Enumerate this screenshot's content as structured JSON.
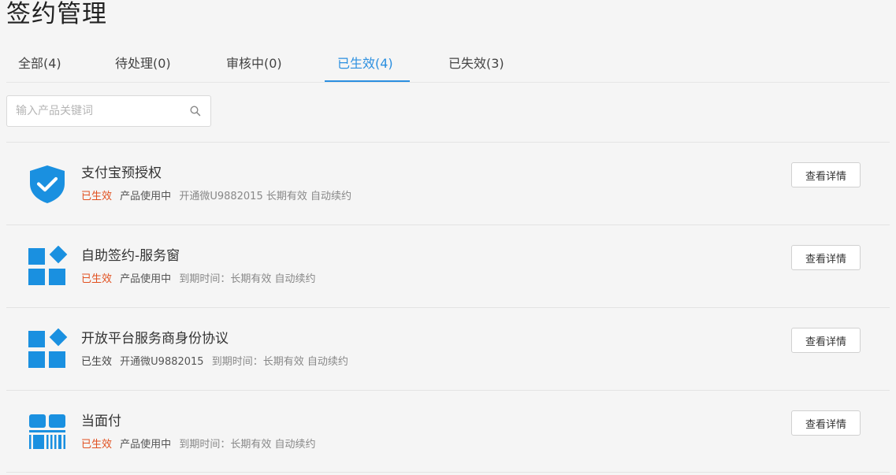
{
  "page": {
    "title": "签约管理"
  },
  "tabs": [
    {
      "label": "全部(4)",
      "active": false
    },
    {
      "label": "待处理(0)",
      "active": false
    },
    {
      "label": "审核中(0)",
      "active": false
    },
    {
      "label": "已生效(4)",
      "active": true
    },
    {
      "label": "已失效(3)",
      "active": false
    }
  ],
  "search": {
    "placeholder": "输入产品关键词",
    "value": ""
  },
  "colors": {
    "accent": "#2b8fe0",
    "icon_blue": "#1a90e0",
    "status_active": "#e1501f"
  },
  "items": [
    {
      "icon": "shield-check-icon",
      "title": "支付宝预授权",
      "status": "已生效",
      "meta1": "产品使用中",
      "meta2": "开通微U9882015 长期有效 自动续约",
      "button": "查看详情"
    },
    {
      "icon": "app-grid-icon",
      "title": "自助签约-服务窗",
      "status": "已生效",
      "meta1": "产品使用中",
      "meta2": "到期时间：长期有效 自动续约",
      "button": "查看详情"
    },
    {
      "icon": "app-grid-icon",
      "title": "开放平台服务商身份协议",
      "status": "已生效",
      "meta1": "开通微U9882015",
      "meta2": "到期时间：长期有效 自动续约",
      "button": "查看详情"
    },
    {
      "icon": "barcode-payment-icon",
      "title": "当面付",
      "status": "已生效",
      "meta1": "产品使用中",
      "meta2": "到期时间：长期有效 自动续约",
      "button": "查看详情"
    }
  ]
}
